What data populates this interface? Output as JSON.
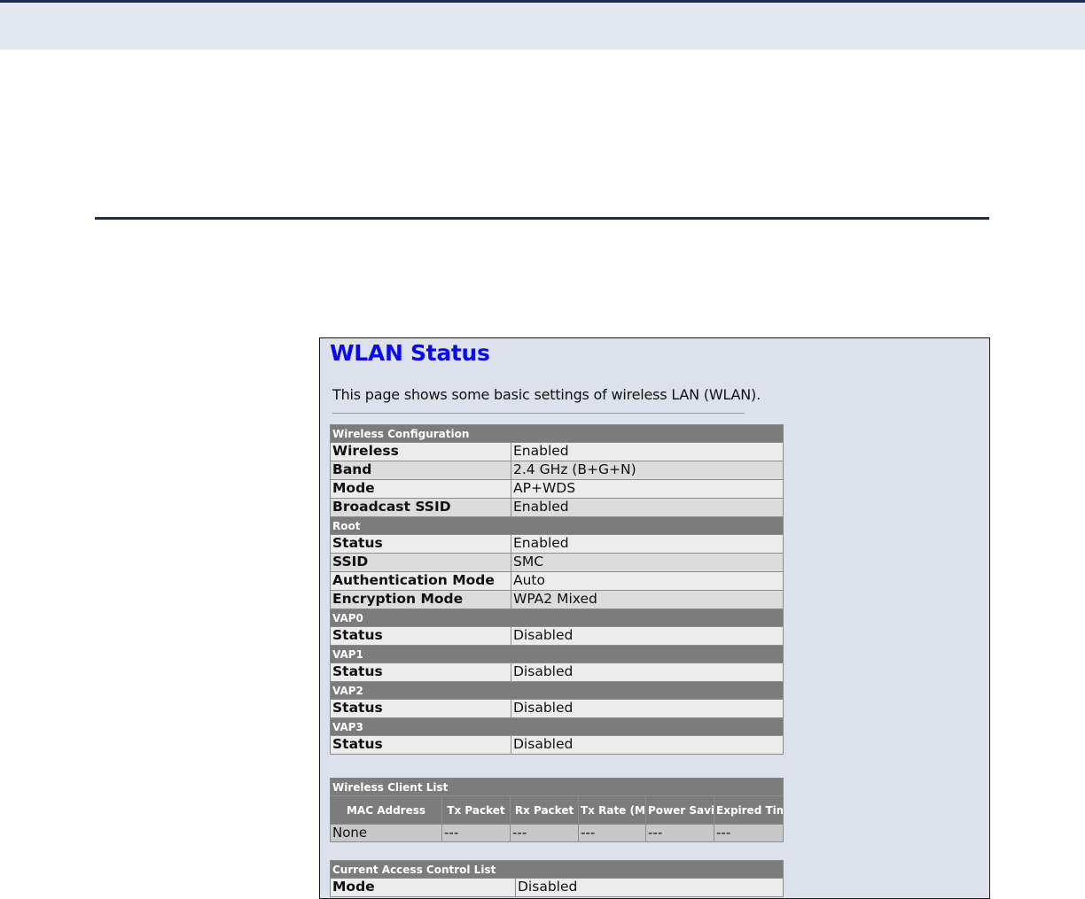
{
  "title": "WLAN Status",
  "description": "This page shows some basic settings of wireless LAN (WLAN).",
  "wireless_config": {
    "header": "Wireless Configuration",
    "rows": [
      {
        "label": "Wireless",
        "value": "Enabled"
      },
      {
        "label": "Band",
        "value": "2.4 GHz (B+G+N)"
      },
      {
        "label": "Mode",
        "value": "AP+WDS"
      },
      {
        "label": "Broadcast SSID",
        "value": "Enabled"
      }
    ]
  },
  "root": {
    "header": "Root",
    "rows": [
      {
        "label": "Status",
        "value": "Enabled"
      },
      {
        "label": "SSID",
        "value": "SMC"
      },
      {
        "label": "Authentication Mode",
        "value": "Auto"
      },
      {
        "label": "Encryption Mode",
        "value": "WPA2 Mixed"
      }
    ]
  },
  "vaps": [
    {
      "header": "VAP0",
      "label": "Status",
      "value": "Disabled"
    },
    {
      "header": "VAP1",
      "label": "Status",
      "value": "Disabled"
    },
    {
      "header": "VAP2",
      "label": "Status",
      "value": "Disabled"
    },
    {
      "header": "VAP3",
      "label": "Status",
      "value": "Disabled"
    }
  ],
  "client_list": {
    "header": "Wireless Client List",
    "columns": [
      "MAC Address",
      "Tx Packet",
      "Rx Packet",
      "Tx Rate (Mbps)",
      "Power Saving",
      "Expired Time (s)"
    ],
    "rows": [
      [
        "None",
        "---",
        "---",
        "---",
        "---",
        "---"
      ]
    ]
  },
  "acl": {
    "header": "Current Access Control List",
    "label": "Mode",
    "value": "Disabled"
  }
}
